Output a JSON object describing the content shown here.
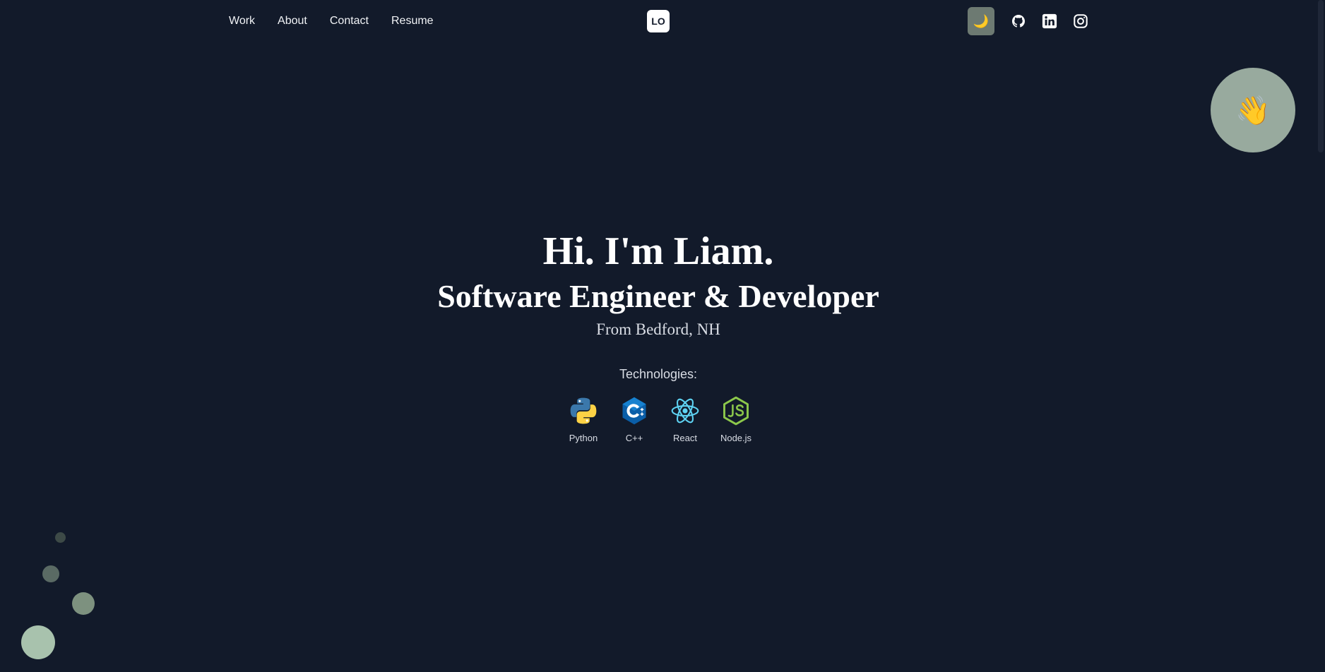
{
  "nav": {
    "links": [
      "Work",
      "About",
      "Contact",
      "Resume"
    ],
    "logo": "LO",
    "theme_toggle_icon": "moon-icon",
    "social_icons": [
      "github-icon",
      "linkedin-icon",
      "instagram-icon"
    ]
  },
  "floating_button_icon": "waving-hand-icon",
  "hero": {
    "title": "Hi. I'm Liam.",
    "subtitle": "Software Engineer & Developer",
    "location": "From Bedford, NH"
  },
  "technologies": {
    "heading": "Technologies:",
    "items": [
      {
        "label": "Python",
        "icon": "python-icon"
      },
      {
        "label": "C++",
        "icon": "cplusplus-icon"
      },
      {
        "label": "React",
        "icon": "react-icon"
      },
      {
        "label": "Node.js",
        "icon": "nodejs-icon"
      }
    ]
  },
  "colors": {
    "background": "#121a2a",
    "accent": "#98aa9e",
    "text": "#ffffff"
  }
}
